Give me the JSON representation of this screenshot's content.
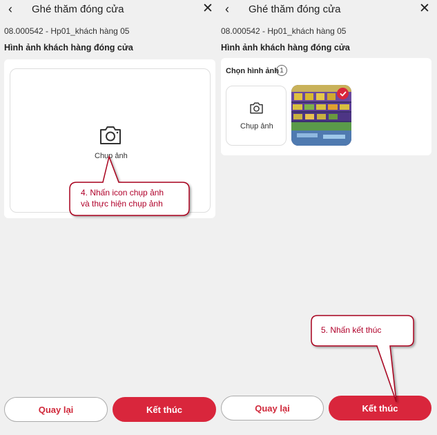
{
  "left": {
    "back_icon": "chevron-left-icon",
    "title": "Ghé thăm đóng cửa",
    "close_icon": "close-icon",
    "customer_code": "08.000542 - Hp01_khách hàng 05",
    "section_title": "Hình ảnh khách hàng đóng cửa",
    "capture_label": "Chụp ảnh",
    "back_button": "Quay lại",
    "finish_button": "Kết thúc"
  },
  "right": {
    "back_icon": "chevron-left-icon",
    "title": "Ghé thăm đóng cửa",
    "close_icon": "close-icon",
    "customer_code": "08.000542 - Hp01_khách hàng 05",
    "section_title": "Hình ảnh khách hàng đóng cửa",
    "choose_label": "Chọn hình ảnh",
    "image_count": "1",
    "capture_label": "Chụp ảnh",
    "back_button": "Quay lại",
    "finish_button": "Kết thúc"
  },
  "callouts": {
    "step4_line1": "4. Nhấn icon chụp ảnh",
    "step4_line2": "và thực hiện chụp ảnh",
    "step5": "5. Nhấn kết thúc"
  },
  "colors": {
    "accent": "#d9263c",
    "callout_border": "#a8001e",
    "background": "#f0f0f0"
  }
}
